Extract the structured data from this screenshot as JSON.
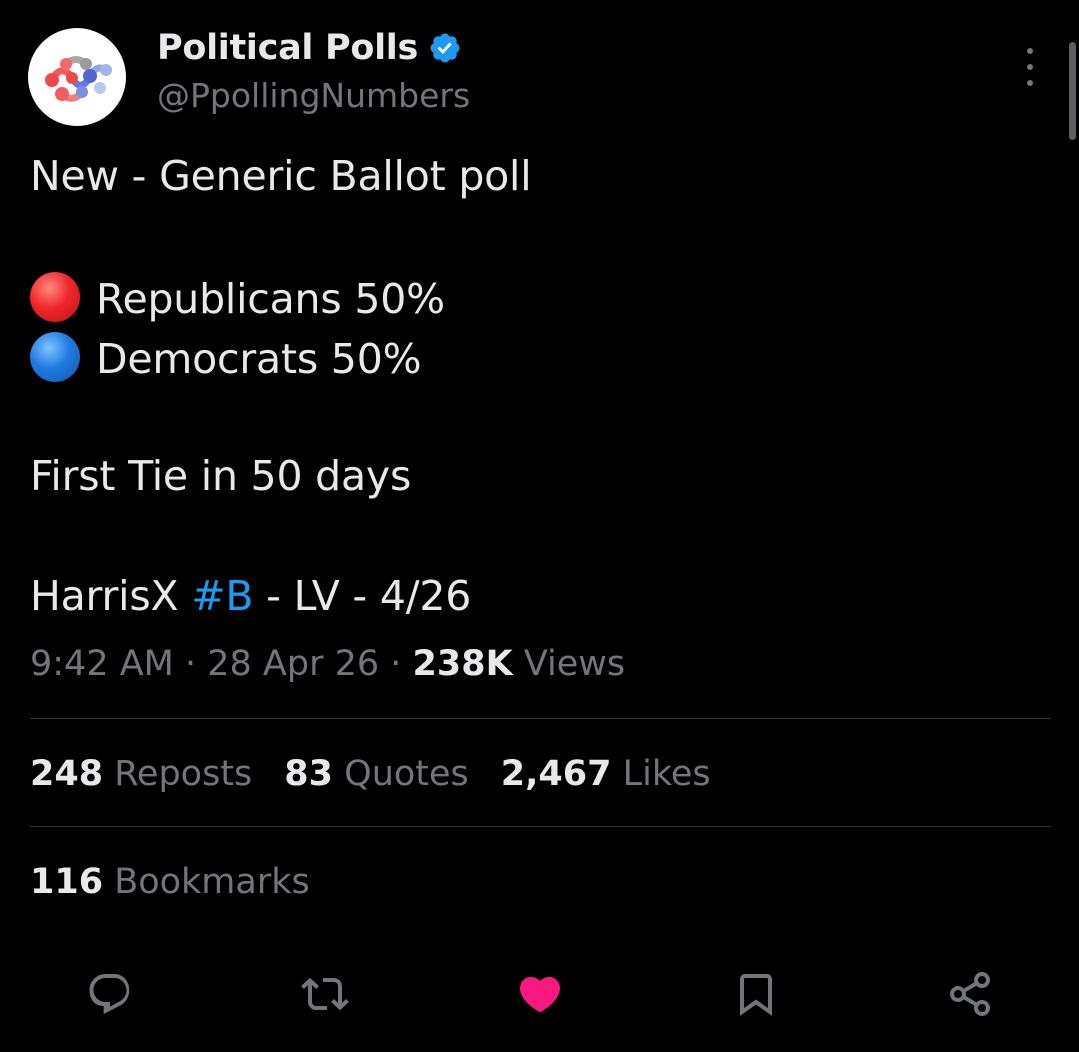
{
  "author": {
    "display_name": "Political Polls",
    "handle": "@PpollingNumbers",
    "verified": true,
    "avatar_icon": "network-logo-icon"
  },
  "post": {
    "line1": "New - Generic Ballot poll",
    "rep_emoji": "red-circle-icon",
    "rep_text": "Republicans 50%",
    "dem_emoji": "blue-circle-icon",
    "dem_text": "Democrats 50%",
    "line4": "First Tie in 50 days",
    "source_prefix": "HarrisX ",
    "hashtag": "#B",
    "source_suffix": " - LV - 4/26"
  },
  "meta": {
    "time": "9:42 AM",
    "sep1": " · ",
    "date": "28 Apr 26",
    "sep2": " · ",
    "views_count": "238K",
    "views_label": " Views"
  },
  "stats": {
    "reposts_count": "248",
    "reposts_label": " Reposts",
    "quotes_count": "83",
    "quotes_label": " Quotes",
    "likes_count": "2,467",
    "likes_label": " Likes",
    "bookmarks_count": "116",
    "bookmarks_label": " Bookmarks"
  },
  "actions": [
    "reply-icon",
    "repost-icon",
    "like-icon",
    "bookmark-icon",
    "share-icon"
  ],
  "colors": {
    "background": "#000000",
    "text": "#e7e9ea",
    "muted": "#71767b",
    "link": "#1d9bf0",
    "like_active": "#f91880",
    "divider": "#2f3336"
  }
}
